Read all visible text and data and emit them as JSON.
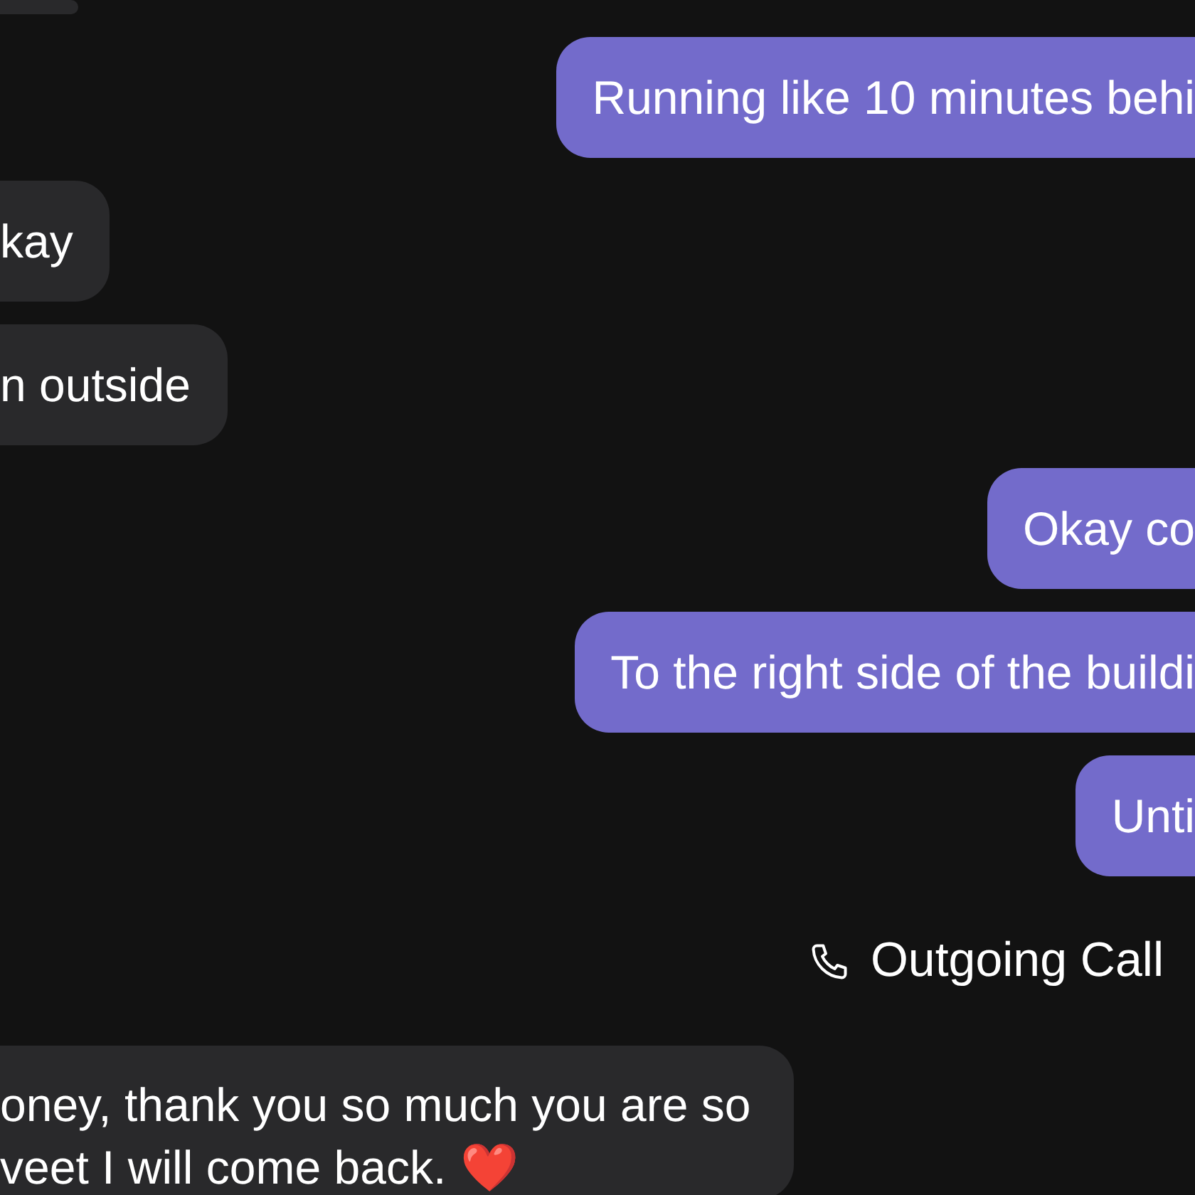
{
  "messages": [
    {
      "outgoing": false,
      "kind": "fragment"
    },
    {
      "outgoing": true,
      "kind": "text",
      "text": "Running like 10 minutes behi"
    },
    {
      "outgoing": false,
      "kind": "text",
      "text": "kay"
    },
    {
      "outgoing": false,
      "kind": "text",
      "text": "n outside"
    },
    {
      "outgoing": true,
      "kind": "text",
      "text": "Okay co"
    },
    {
      "outgoing": true,
      "kind": "text",
      "text": "To the right side of the buildi"
    },
    {
      "outgoing": true,
      "kind": "text",
      "text": "Unti"
    },
    {
      "outgoing": true,
      "kind": "call",
      "text": "Outgoing Call"
    },
    {
      "outgoing": false,
      "kind": "text",
      "lines": [
        "oney, thank you so much you are so",
        "veet I will come back."
      ],
      "emoji": "❤️"
    }
  ]
}
